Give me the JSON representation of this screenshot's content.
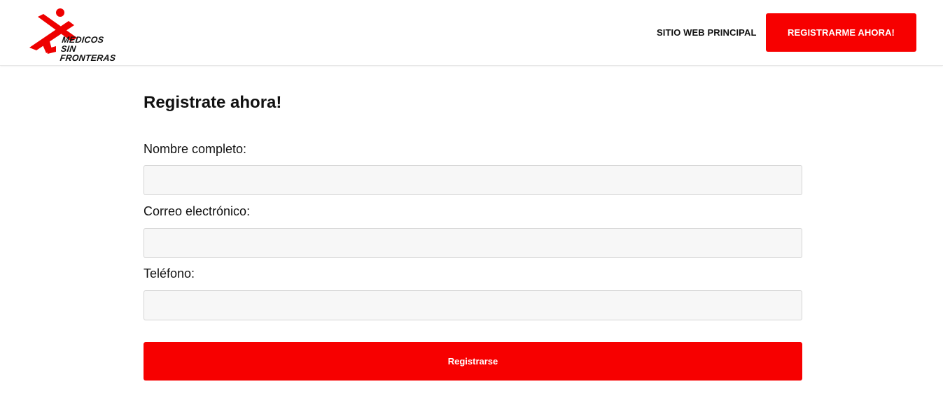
{
  "header": {
    "logo": {
      "line1": "MEDICOS",
      "line2": "SIN FRONTERAS",
      "icon": "msf-running-figure-logo"
    },
    "nav_link": "SITIO WEB PRINCIPAL",
    "cta_label": "REGISTRARME AHORA!"
  },
  "form": {
    "title": "Registrate ahora!",
    "fields": [
      {
        "label": "Nombre completo:",
        "value": "",
        "placeholder": ""
      },
      {
        "label": "Correo electrónico:",
        "value": "",
        "placeholder": ""
      },
      {
        "label": "Teléfono:",
        "value": "",
        "placeholder": ""
      }
    ],
    "submit_label": "Registrarse"
  },
  "colors": {
    "brand_red": "#f70000",
    "text": "#111111",
    "input_bg": "#f7f7f7",
    "input_border": "#d4d4d4"
  }
}
